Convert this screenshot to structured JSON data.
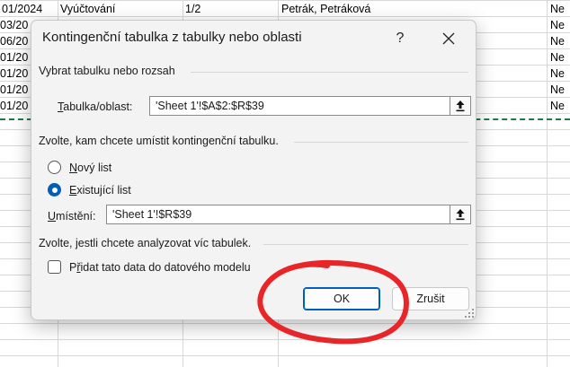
{
  "sheet": {
    "rows": [
      {
        "a": "01/2024",
        "b": "Vyúčtování",
        "c": "1/2",
        "d": "Petrák, Petráková",
        "e": "Ne"
      },
      {
        "a": "03/20",
        "b": "",
        "c": "",
        "d": "",
        "e": "Ne"
      },
      {
        "a": "06/20",
        "b": "",
        "c": "",
        "d": "",
        "e": "Ne"
      },
      {
        "a": "01/20",
        "b": "",
        "c": "",
        "d": "",
        "e": "Ne"
      },
      {
        "a": "01/20",
        "b": "",
        "c": "",
        "d": "",
        "e": "Ne"
      },
      {
        "a": "01/20",
        "b": "",
        "c": "",
        "d": "",
        "e": "Ne"
      },
      {
        "a": "01/20",
        "b": "",
        "c": "",
        "d": "",
        "e": "Ne"
      }
    ]
  },
  "dialog": {
    "title": "Kontingenční tabulka z tabulky nebo oblasti",
    "help_label": "?",
    "section_choose_table": "Vybrat tabulku nebo rozsah",
    "table_range_label_prefix": "T",
    "table_range_label_rest": "abulka/oblast:",
    "table_range_value": "'Sheet 1'!$A$2:$R$39",
    "section_placement": "Zvolte, kam chcete umístit kontingenční tabulku.",
    "radio_new_sheet_prefix": "N",
    "radio_new_sheet_rest": "ový list",
    "radio_existing_sheet_prefix": "E",
    "radio_existing_sheet_rest": "xistující list",
    "location_label_prefix": "U",
    "location_label_rest": "místění:",
    "location_value": "'Sheet 1'!$R$39",
    "section_multiple": "Zvolte, jestli chcete analyzovat víc tabulek.",
    "data_model_prefix": "P",
    "data_model_underlined": "ř",
    "data_model_rest": "idat tato data do datového modelu",
    "ok_label": "OK",
    "cancel_label": "Zrušit",
    "selected_placement": "existing",
    "data_model_checked": false
  },
  "colors": {
    "accent": "#005fb8",
    "annotation": "#e8262a",
    "marquee": "#1d7a46"
  }
}
